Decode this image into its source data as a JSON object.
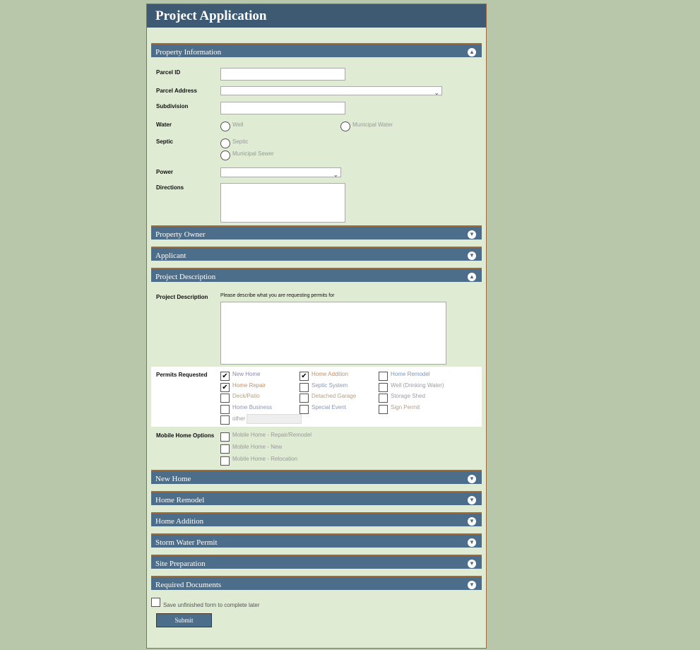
{
  "title": "Project Application",
  "sections": {
    "property_information": "Property Information",
    "property_owner": "Property Owner",
    "applicant": "Applicant",
    "project_description": "Project Description",
    "new_home": "New Home",
    "home_remodel": "Home Remodel",
    "home_addition": "Home Addition",
    "storm_water": "Storm Water Permit",
    "site_preparation": "Site Preparation",
    "required_documents": "Required Documents"
  },
  "property": {
    "parcel_id": "Parcel ID",
    "parcel_address": "Parcel Address",
    "subdivision": "Subdivision",
    "water": "Water",
    "water_options": [
      "Well",
      "Municipal Water"
    ],
    "septic": "Septic",
    "septic_options": [
      "Septic",
      "Municipal Sewer"
    ],
    "power": "Power",
    "directions": "Directions"
  },
  "project": {
    "label": "Project Description",
    "hint": "Please describe what you are requesting permits for",
    "permits_label": "Permits Requested",
    "permits": [
      {
        "label": "New Home",
        "checked": true,
        "color": "#8a86b0"
      },
      {
        "label": "Home Addition",
        "checked": true,
        "color": "#c0906a"
      },
      {
        "label": "Home Remodel",
        "checked": false,
        "color": "#7a96c0"
      },
      {
        "label": "Home Repair",
        "checked": true,
        "color": "#c0906a"
      },
      {
        "label": "Septic System",
        "checked": false,
        "color": "#8a96b0"
      },
      {
        "label": "Well (Drinking Water)",
        "checked": false,
        "color": "#a09aa6"
      },
      {
        "label": "Deck/Patio",
        "checked": false,
        "color": "#b0a08a"
      },
      {
        "label": "Detached Garage",
        "checked": false,
        "color": "#b0a08a"
      },
      {
        "label": "Storage Shed",
        "checked": false,
        "color": "#a09aa6"
      },
      {
        "label": "Home Business",
        "checked": false,
        "color": "#8a96b0"
      },
      {
        "label": "Special Event",
        "checked": false,
        "color": "#8a96b0"
      },
      {
        "label": "Sign Permit",
        "checked": false,
        "color": "#b0a08a"
      }
    ],
    "other": "other",
    "mobile_label": "Mobile Home Options",
    "mobile": [
      "Mobile Home - Repair/Remodel",
      "Mobile Home - New",
      "Mobile Home - Relocation"
    ]
  },
  "save_later": "Save unfinished form to complete later",
  "submit": "Submit"
}
